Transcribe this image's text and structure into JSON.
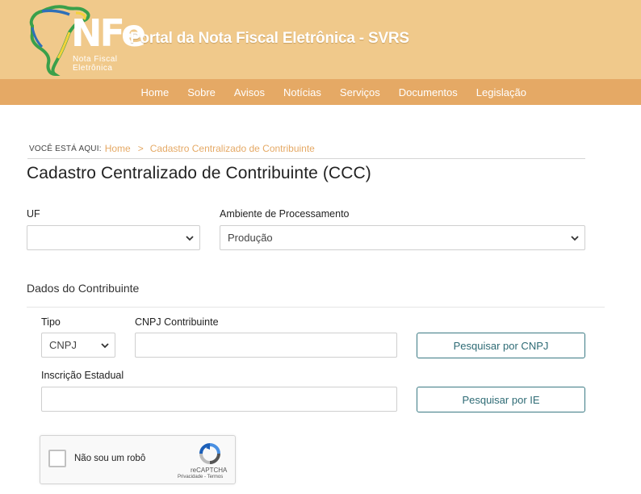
{
  "header": {
    "logo_text": "NFe",
    "logo_subtitle_line1": "Nota Fiscal",
    "logo_subtitle_line2": "Eletrônica",
    "title": "Portal da Nota Fiscal Eletrônica - SVRS"
  },
  "nav": {
    "items": [
      {
        "label": "Home"
      },
      {
        "label": "Sobre"
      },
      {
        "label": "Avisos"
      },
      {
        "label": "Notícias"
      },
      {
        "label": "Serviços"
      },
      {
        "label": "Documentos"
      },
      {
        "label": "Legislação"
      }
    ]
  },
  "breadcrumb": {
    "prefix": "VOCÊ ESTÁ AQUI:",
    "home": "Home",
    "separator": ">",
    "current": "Cadastro Centralizado de Contribuinte"
  },
  "page": {
    "title": "Cadastro Centralizado de Contribuinte (CCC)"
  },
  "form": {
    "uf_label": "UF",
    "uf_value": "",
    "ambiente_label": "Ambiente de Processamento",
    "ambiente_value": "Produção",
    "section_title": "Dados do Contribuinte",
    "tipo_label": "Tipo",
    "tipo_value": "CNPJ",
    "cnpj_label": "CNPJ Contribuinte",
    "cnpj_value": "",
    "ie_label": "Inscrição Estadual",
    "ie_value": "",
    "btn_cnpj": "Pesquisar por CNPJ",
    "btn_ie": "Pesquisar por IE"
  },
  "recaptcha": {
    "label": "Não sou um robô",
    "brand": "reCAPTCHA",
    "terms": "Privacidade - Termos"
  },
  "colors": {
    "header_bg": "#f0c98b",
    "nav_bg": "#e5a965",
    "link": "#e5a965",
    "button_border": "#3b7a84"
  }
}
